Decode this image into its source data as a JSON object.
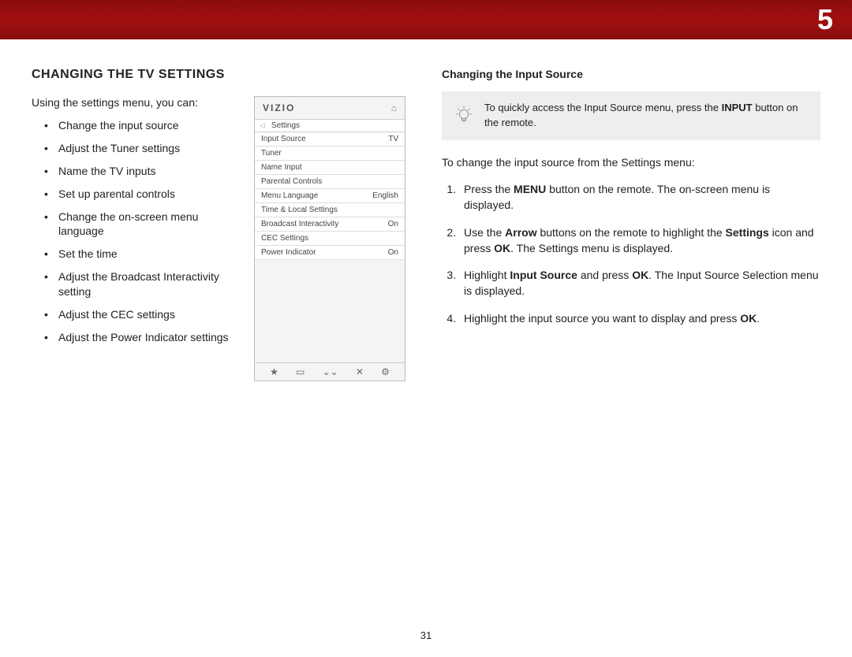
{
  "header": {
    "chapter": "5"
  },
  "left": {
    "title": "CHANGING THE TV SETTINGS",
    "intro": "Using the settings menu, you can:",
    "bullets": [
      "Change the input source",
      "Adjust the Tuner settings",
      "Name the TV inputs",
      "Set up parental controls",
      "Change the on-screen menu language",
      "Set the time",
      "Adjust the Broadcast Interactivity setting",
      "Adjust the CEC settings",
      "Adjust the Power Indicator settings"
    ]
  },
  "tv": {
    "brand": "VIZIO",
    "breadcrumb": "Settings",
    "rows": [
      {
        "label": "Input Source",
        "value": "TV"
      },
      {
        "label": "Tuner",
        "value": ""
      },
      {
        "label": "Name Input",
        "value": ""
      },
      {
        "label": "Parental Controls",
        "value": ""
      },
      {
        "label": "Menu Language",
        "value": "English"
      },
      {
        "label": "Time & Local Settings",
        "value": ""
      },
      {
        "label": "Broadcast Interactivity",
        "value": "On"
      },
      {
        "label": "CEC Settings",
        "value": ""
      },
      {
        "label": "Power Indicator",
        "value": "On"
      }
    ],
    "bottom_icons": [
      "★",
      "▭",
      "⌄⌄",
      "✕",
      "⚙"
    ]
  },
  "right": {
    "title": "Changing the Input Source",
    "tip_a": "To quickly access the Input Source menu, press the ",
    "tip_bold": "INPUT",
    "tip_b": " button on the remote.",
    "lead": "To change the input source from the Settings menu:",
    "steps": {
      "s1_a": "Press the ",
      "s1_bold": "MENU",
      "s1_b": " button on the remote. The on-screen menu is displayed.",
      "s2_a": "Use the ",
      "s2_bold1": "Arrow",
      "s2_b": " buttons on the remote to highlight the ",
      "s2_bold2": "Settings",
      "s2_c": " icon and press ",
      "s2_bold3": "OK",
      "s2_d": ". The Settings menu is displayed.",
      "s3_a": "Highlight ",
      "s3_bold1": "Input Source",
      "s3_b": " and press ",
      "s3_bold2": "OK",
      "s3_c": ". The Input Source Selection menu is displayed.",
      "s4_a": "Highlight the input source you want to display and press ",
      "s4_bold": "OK",
      "s4_b": "."
    }
  },
  "page_number": "31"
}
